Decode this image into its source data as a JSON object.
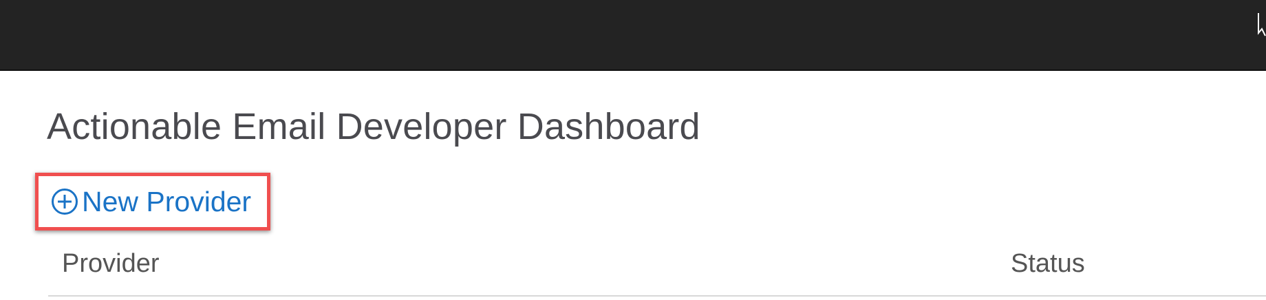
{
  "page": {
    "title": "Actionable Email Developer Dashboard"
  },
  "actions": {
    "new_provider_label": "New Provider"
  },
  "table": {
    "columns": [
      "Provider",
      "Status"
    ]
  },
  "colors": {
    "topbar": "#232323",
    "title_text": "#4a4a4f",
    "link_blue": "#1a73c6",
    "highlight_border": "#f04f4f",
    "divider": "#d8d8d8"
  },
  "icons": {
    "new_provider": "plus-circle-icon",
    "pointer": "mouse-cursor-icon"
  }
}
